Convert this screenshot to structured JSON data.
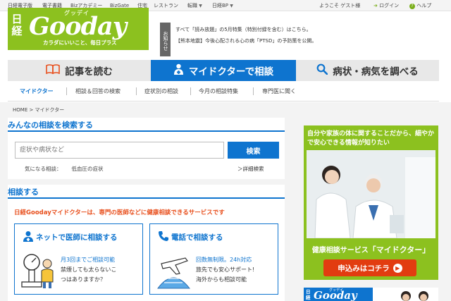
{
  "topbar": {
    "links": [
      "日経電子版",
      "電子書籍",
      "Bizアカデミー",
      "BizGate",
      "住宅",
      "レストラン",
      "転職",
      "日経BP"
    ],
    "welcome": "ようこそ ゲスト様",
    "login": "ログイン",
    "help": "ヘルプ"
  },
  "logo": {
    "nikkei": "日経",
    "gooday": "Gooday",
    "gooday_kana": "グッデイ",
    "tagline": "カラダにいいこと、毎日プラス"
  },
  "notice": {
    "tag": "お知らせ",
    "items": [
      "すべて「読み放題」の5月特集（特別付録を含む）はこちら。",
      "【熊本地震】今後心配される心の病「PTSD」の予防策を公開。"
    ]
  },
  "tabs": [
    {
      "label": "記事を読む",
      "icon": "book-icon"
    },
    {
      "label": "マイドクターで相談",
      "icon": "doctor-icon"
    },
    {
      "label": "病状・病気を調べる",
      "icon": "magnifier-icon"
    }
  ],
  "subnav": [
    "マイドクター",
    "相談＆回答の検索",
    "症状別の相談",
    "今月の相談特集",
    "専門医に聞く"
  ],
  "breadcrumb": "HOME > マイドクター",
  "search_section": {
    "title": "みんなの相談を検索する",
    "placeholder": "症状や病状など",
    "button": "検索",
    "interest_label": "気になる相談：",
    "interest_value": "低血圧の症状",
    "advanced_link": "＞詳細検索"
  },
  "consult_section": {
    "title": "相談する",
    "lead": "日経Goodayマイドクターは、専門の医師などに健康相談できるサービスです",
    "cards": [
      {
        "title": "ネットで医師に相談する",
        "icon": "doctor-avatar-icon",
        "lines": [
          "月3回までご相談可能",
          "禁煙しても太らないこ",
          "つはありますか？"
        ]
      },
      {
        "title": "電話で相談する",
        "icon": "phone-icon",
        "lines": [
          "回数無制限。24h対応",
          "旅先でも安心サポート!",
          "海外からも相談可能"
        ]
      }
    ]
  },
  "ad": {
    "headline": "自分や家族の体に関することだから、細やかで安心できる情報が知りたい",
    "service_prefix": "健康相談サービス",
    "service_name": "「マイドクター」",
    "cta": "申込みはコチラ"
  },
  "ad2": {
    "nikkei": "日経",
    "gooday": "Gooday",
    "gooday_kana": "グッデイ"
  },
  "colors": {
    "brand_green": "#8cc11f",
    "accent_blue": "#0e74cf",
    "lead_orange": "#e8501e",
    "cta_red": "#e23c10"
  }
}
